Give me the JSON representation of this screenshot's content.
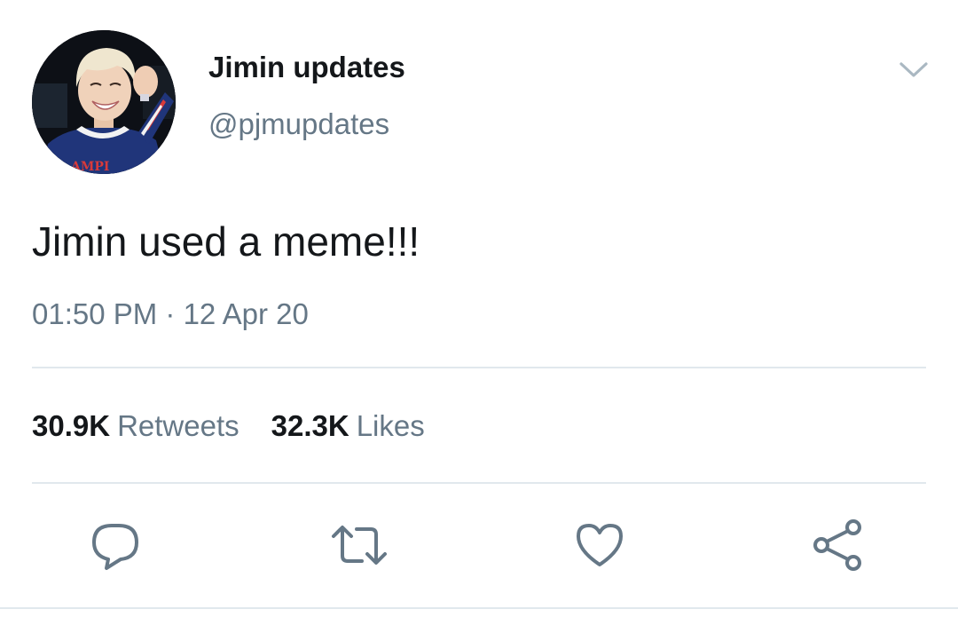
{
  "tweet": {
    "display_name": "Jimin updates",
    "handle": "@pjmupdates",
    "text": "Jimin used a meme!!!",
    "timestamp": "01:50 PM · 12 Apr 20",
    "avatar_shirt_text": "AMPI"
  },
  "stats": {
    "retweets_count": "30.9K",
    "retweets_label": "Retweets",
    "likes_count": "32.3K",
    "likes_label": "Likes"
  },
  "actions": [
    {
      "icon": "reply-icon"
    },
    {
      "icon": "retweet-icon"
    },
    {
      "icon": "like-icon"
    },
    {
      "icon": "share-icon"
    }
  ],
  "colors": {
    "primary_text": "#14171a",
    "secondary_text": "#657786",
    "divider": "#e1e8ed",
    "icon": "#657786"
  }
}
